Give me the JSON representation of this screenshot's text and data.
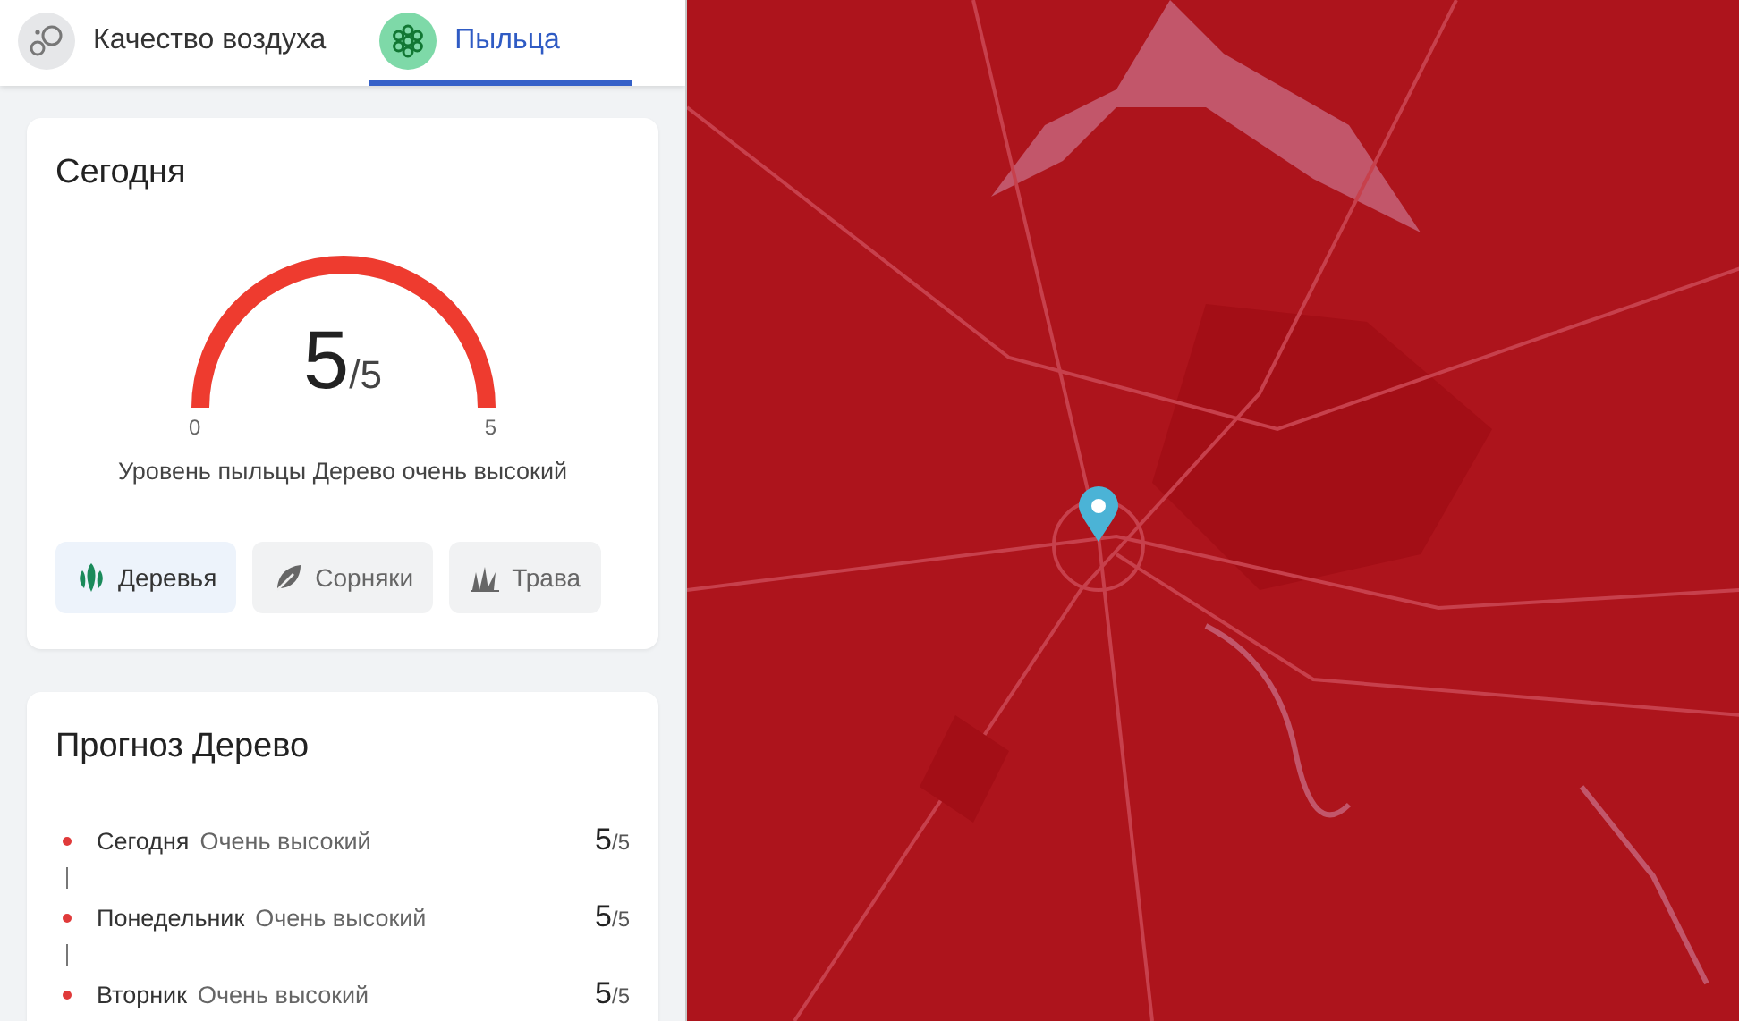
{
  "tabs": [
    {
      "label": "Качество воздуха",
      "kind": "air",
      "selected": false
    },
    {
      "label": "Пыльца",
      "kind": "pollen",
      "selected": true
    }
  ],
  "today": {
    "title": "Сегодня",
    "gauge": {
      "value": "5",
      "max": "/5",
      "min_label": "0",
      "max_label": "5"
    },
    "description": "Уровень пыльцы Дерево очень высокий",
    "categories": [
      {
        "label": "Деревья",
        "kind": "trees",
        "selected": true
      },
      {
        "label": "Сорняки",
        "kind": "weeds",
        "selected": false
      },
      {
        "label": "Трава",
        "kind": "grass",
        "selected": false
      }
    ]
  },
  "forecast": {
    "title": "Прогноз Дерево",
    "days": [
      {
        "day": "Сегодня",
        "level_text": "Очень высокий",
        "value": "5",
        "max": "/5",
        "color": "#e03a3a"
      },
      {
        "day": "Понедельник",
        "level_text": "Очень высокий",
        "value": "5",
        "max": "/5",
        "color": "#e03a3a"
      },
      {
        "day": "Вторник",
        "level_text": "Очень высокий",
        "value": "5",
        "max": "/5",
        "color": "#e03a3a"
      }
    ]
  }
}
